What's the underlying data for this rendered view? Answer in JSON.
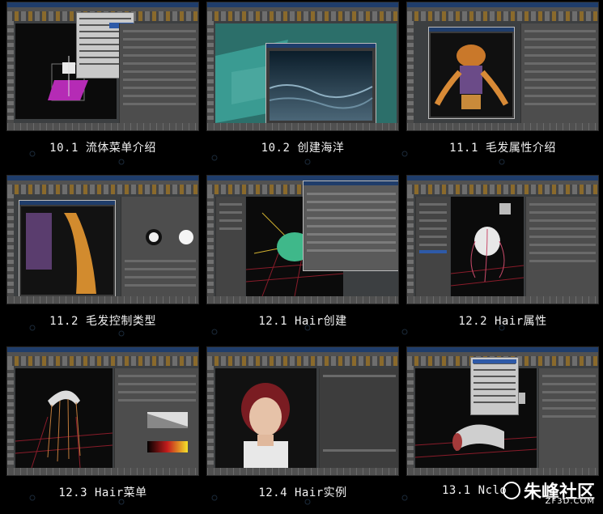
{
  "tutorials": [
    {
      "caption": "10.1 流体菜单介绍"
    },
    {
      "caption": "10.2 创建海洋"
    },
    {
      "caption": "11.1 毛发属性介绍"
    },
    {
      "caption": "11.2 毛发控制类型"
    },
    {
      "caption": "12.1 Hair创建"
    },
    {
      "caption": "12.2 Hair属性"
    },
    {
      "caption": "12.3 Hair菜单"
    },
    {
      "caption": "12.4 Hair实例"
    },
    {
      "caption": "13.1 Nclo"
    }
  ],
  "watermark": {
    "title": "朱峰社区",
    "url": "ZF3D.COM"
  },
  "colors": {
    "background": "#000000",
    "caption": "#f2f2f2",
    "maya_title": "#1f3d6b"
  }
}
